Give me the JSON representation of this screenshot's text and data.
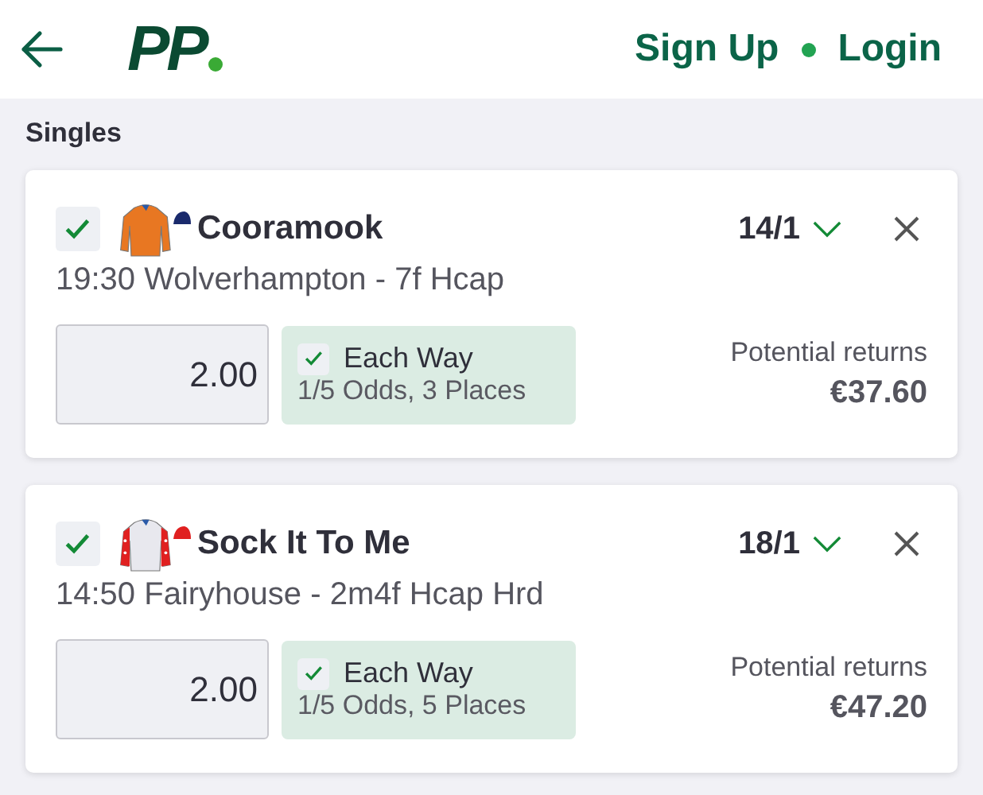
{
  "header": {
    "logo": "PP",
    "links": [
      {
        "label": "Sign Up"
      },
      {
        "label": "Login"
      }
    ]
  },
  "section_title": "Singles",
  "bets": [
    {
      "selected": true,
      "name": "Cooramook",
      "silk": {
        "kind": "plain",
        "color": "#e87722"
      },
      "cap": {
        "color": "#1a2a6c"
      },
      "odds": "14/1",
      "race": "19:30 Wolverhampton - 7f Hcap",
      "stake": "2.00",
      "each_way": {
        "checked": true,
        "label": "Each Way",
        "terms": "1/5 Odds, 3 Places"
      },
      "returns_label": "Potential returns",
      "returns": "€37.60"
    },
    {
      "selected": true,
      "name": "Sock It To Me",
      "silk": {
        "kind": "starred",
        "color": "#e02020"
      },
      "cap": {
        "color": "#e02020"
      },
      "odds": "18/1",
      "race": "14:50 Fairyhouse - 2m4f Hcap Hrd",
      "stake": "2.00",
      "each_way": {
        "checked": true,
        "label": "Each Way",
        "terms": "1/5 Odds, 5 Places"
      },
      "returns_label": "Potential returns",
      "returns": "€47.20"
    }
  ]
}
